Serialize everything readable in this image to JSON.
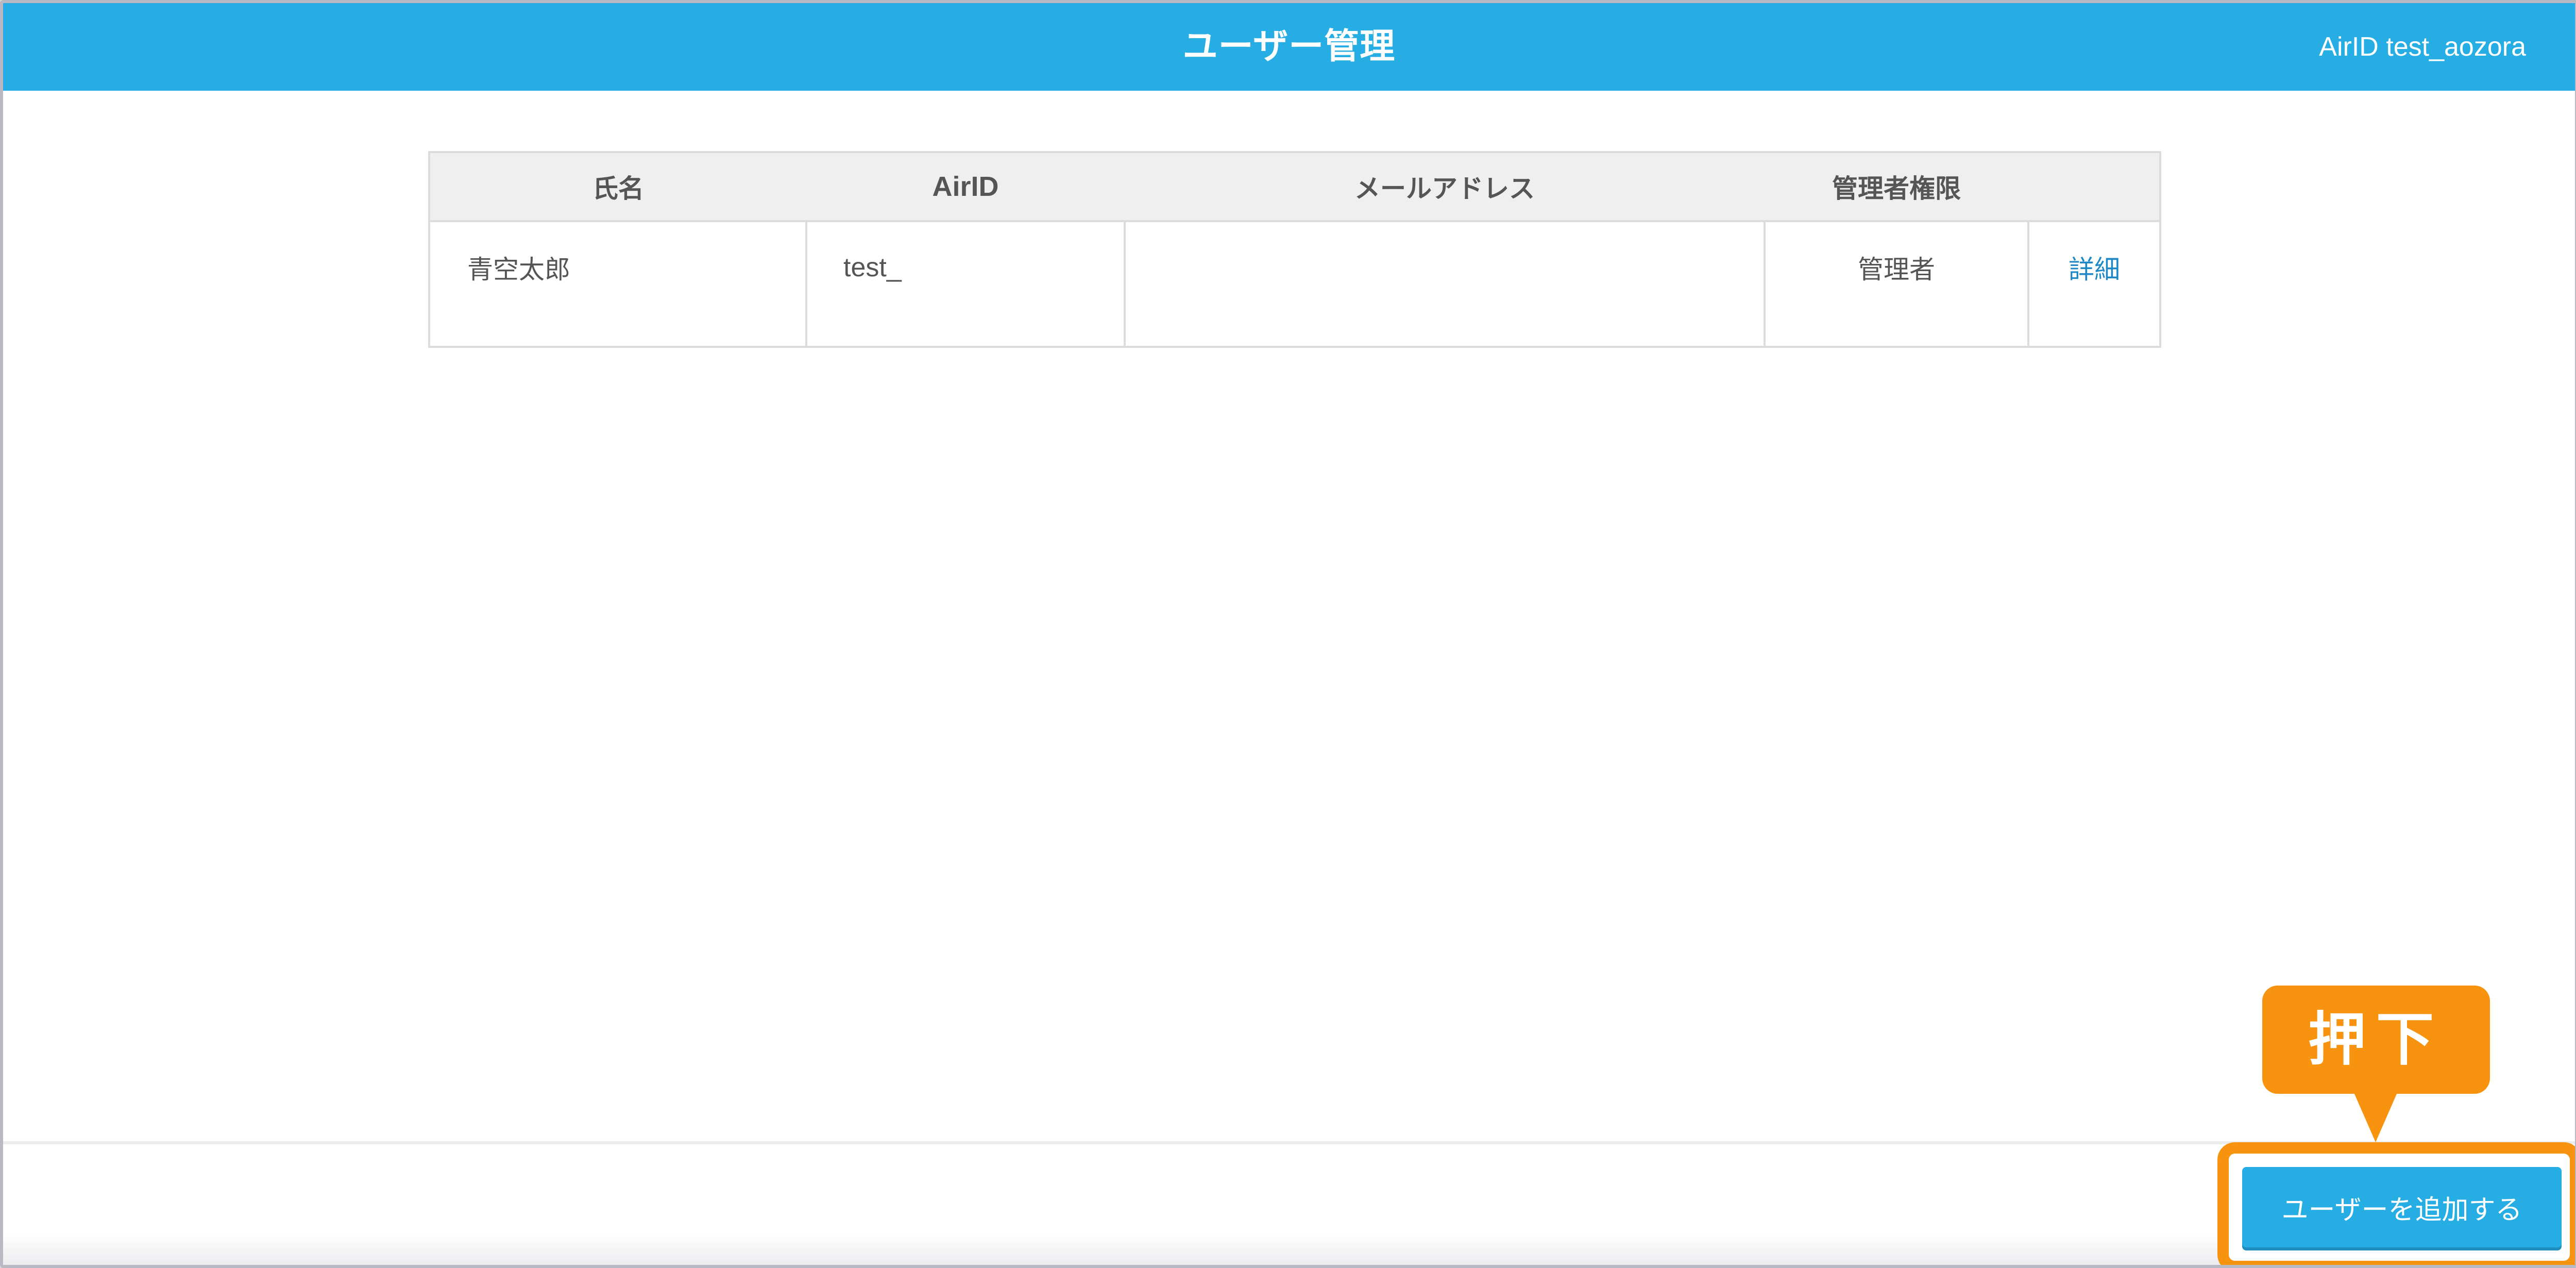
{
  "header": {
    "title": "ユーザー管理",
    "user_label": "AirID test_aozora"
  },
  "table": {
    "columns": [
      "氏名",
      "AirID",
      "メールアドレス",
      "管理者権限",
      ""
    ],
    "rows": [
      {
        "name": "青空太郎",
        "airid": "test_",
        "email": "",
        "role": "管理者",
        "detail_link": "詳細"
      }
    ]
  },
  "footer": {
    "add_user_label": "ユーザーを追加する"
  },
  "annotation": {
    "callout_text": "押下",
    "color": "#f7930f"
  },
  "colors": {
    "header_bg": "#26ade4",
    "link": "#1e88c7",
    "button_bg": "#26ade4"
  }
}
